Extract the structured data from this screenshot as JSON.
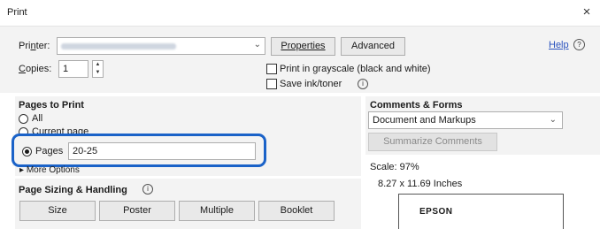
{
  "window": {
    "title": "Print",
    "close_glyph": "×"
  },
  "printer": {
    "label_pre": "Pri",
    "label_u": "n",
    "label_post": "ter:",
    "value_obscured": true
  },
  "buttons": {
    "properties": "Properties",
    "advanced": "Advanced",
    "help": "Help"
  },
  "copies": {
    "label_u": "C",
    "label_post": "opies:",
    "value": "1"
  },
  "options": {
    "grayscale": "Print in grayscale (black and white)",
    "save_ink": "Save ink/toner"
  },
  "pages_to_print": {
    "heading": "Pages to Print",
    "all_label": "All",
    "current_page_label": "Current page",
    "pages_label": "Pages",
    "pages_value": "20-25",
    "more_options": "More Options"
  },
  "page_sizing": {
    "heading": "Page Sizing & Handling",
    "tabs": [
      "Size",
      "Poster",
      "Multiple",
      "Booklet"
    ]
  },
  "comments_forms": {
    "heading": "Comments & Forms",
    "selected": "Document and Markups",
    "summarize": "Summarize Comments"
  },
  "preview": {
    "scale": "Scale: 97%",
    "size": "8.27 x 11.69 Inches",
    "brand": "EPSON"
  }
}
